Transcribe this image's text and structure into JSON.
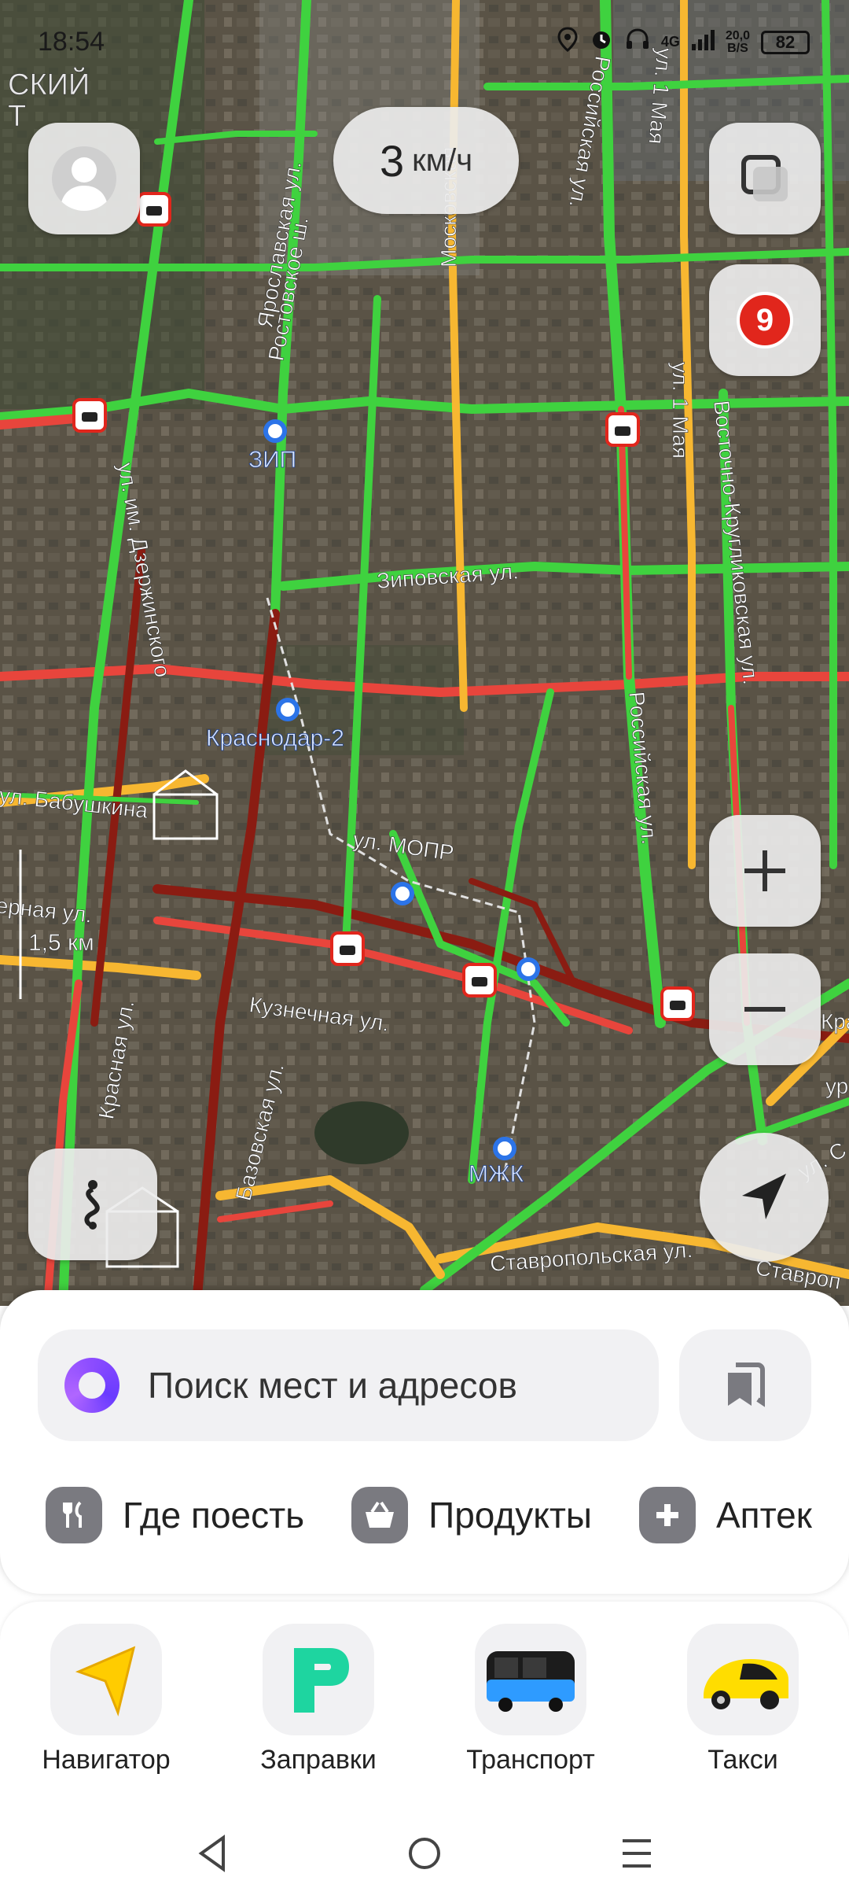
{
  "status_bar": {
    "time": "18:54",
    "network": "4G",
    "net_speed_value": "20,0",
    "net_speed_unit": "B/S",
    "battery": "82"
  },
  "map": {
    "speed_value": "3",
    "speed_unit": "км/ч",
    "traffic_level": "9",
    "scale_label": "1,5 км",
    "labels": {
      "zip": "ЗИП",
      "krasnodar2": "Краснодар-2",
      "mzhk": "МЖК",
      "zipovskaya": "Зиповская ул.",
      "mopr": "ул. МОПР",
      "kuznechnaya": "Кузнечная ул.",
      "rossiyskaya": "Российская ул.",
      "rossiyskaya_top": "Российская ул.",
      "stavropolskaya": "Ставропольская ул.",
      "stavropolskaya2": "Ставроп",
      "krasnaya": "Красная ул.",
      "bazovskaya": "Базовская ул.",
      "dzerzhinskogo": "ул. им. Дзержинского",
      "babushkina": "ул. Бабушкина",
      "rostovskoe": "Ростовское ш.",
      "moskovskaya": "Московская",
      "yaroslavskaya": "Ярославская ул.",
      "pervogo_maya": "ул. 1 Мая",
      "pervogo_maya_top": "ул. 1 Мая",
      "vostochno": "Восточно-Кругликовская ул.",
      "district_top": "СКИЙ",
      "district_top2": "Т",
      "severnaya": "ерная ул.",
      "kra": "Кра",
      "ul_s": "ул. С",
      "ur": "ур"
    }
  },
  "search": {
    "placeholder": "Поиск мест и адресов"
  },
  "chips": [
    {
      "label": "Где поесть",
      "icon": "fork-knife-icon"
    },
    {
      "label": "Продукты",
      "icon": "basket-icon"
    },
    {
      "label": "Аптек",
      "icon": "plus-icon"
    }
  ],
  "services": [
    {
      "label": "Навигатор",
      "icon": "navigator-arrow-icon"
    },
    {
      "label": "Заправки",
      "icon": "gas-station-icon"
    },
    {
      "label": "Транспорт",
      "icon": "bus-icon"
    },
    {
      "label": "Такси",
      "icon": "taxi-icon"
    }
  ],
  "colors": {
    "traffic_green": "#3fd23f",
    "traffic_yellow": "#f7b731",
    "traffic_red": "#e8453c",
    "traffic_darkred": "#8a1c12",
    "alice_purple": "#8c4cff"
  }
}
